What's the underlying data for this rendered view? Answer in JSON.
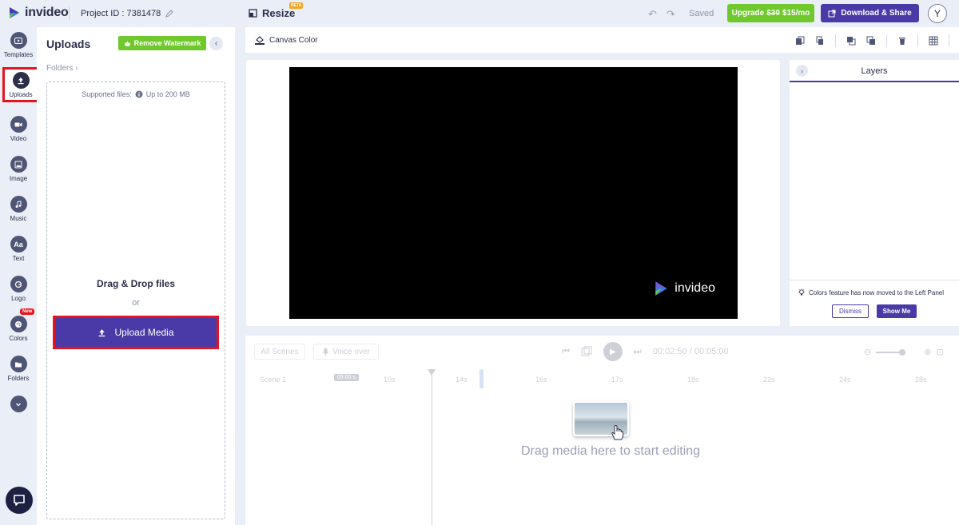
{
  "app": {
    "name": "invideo",
    "project_id": "Project ID : 7381478",
    "resize_label": "Resize",
    "beta_label": "BETA",
    "saved_label": "Saved",
    "upgrade": {
      "label": "Upgrade",
      "old_price": "$30",
      "new_price": "$15/mo"
    },
    "download_label": "Download & Share",
    "avatar_initial": "Y",
    "accent_color": "#4a3aa7",
    "green_color": "#6fc92d",
    "highlight_color": "#e8141d"
  },
  "leftnav": {
    "items": [
      {
        "label": "Templates",
        "icon": "play-icon"
      },
      {
        "label": "Uploads",
        "icon": "upload-icon",
        "active": true
      },
      {
        "label": "Video",
        "icon": "video-camera-icon"
      },
      {
        "label": "Image",
        "icon": "image-icon"
      },
      {
        "label": "Music",
        "icon": "music-note-icon"
      },
      {
        "label": "Text",
        "icon": "text-icon",
        "glyph": "Aa"
      },
      {
        "label": "Logo",
        "icon": "logo-icon"
      },
      {
        "label": "Colors",
        "icon": "palette-icon",
        "badge": "New"
      },
      {
        "label": "Folders",
        "icon": "folder-icon"
      }
    ]
  },
  "uploads": {
    "title": "Uploads",
    "remove_watermark": "Remove Watermark",
    "folders_crumb": "Folders",
    "supported_files": "Supported files:",
    "size_limit": "Up to 200 MB",
    "drag_drop": "Drag & Drop files",
    "or": "or",
    "upload_media": "Upload Media"
  },
  "canvas": {
    "canvas_color_label": "Canvas Color",
    "watermark_text": "invideo"
  },
  "layers": {
    "title": "Layers",
    "note": "Colors feature has now moved to the Left Panel",
    "dismiss": "Dismiss",
    "show_me": "Show Me"
  },
  "timeline": {
    "all_scenes": "All Scenes",
    "voice_over": "Voice over",
    "time_current": "00:02:50",
    "time_total": "00:05:00",
    "time_sep": "/",
    "scene_label": "Scene 1",
    "scene_duration": "05:00 s",
    "ticks": [
      "10s",
      "14s",
      "16s",
      "17s",
      "18s",
      "22s",
      "24s",
      "28s"
    ],
    "drag_hint": "Drag media here to start editing"
  }
}
